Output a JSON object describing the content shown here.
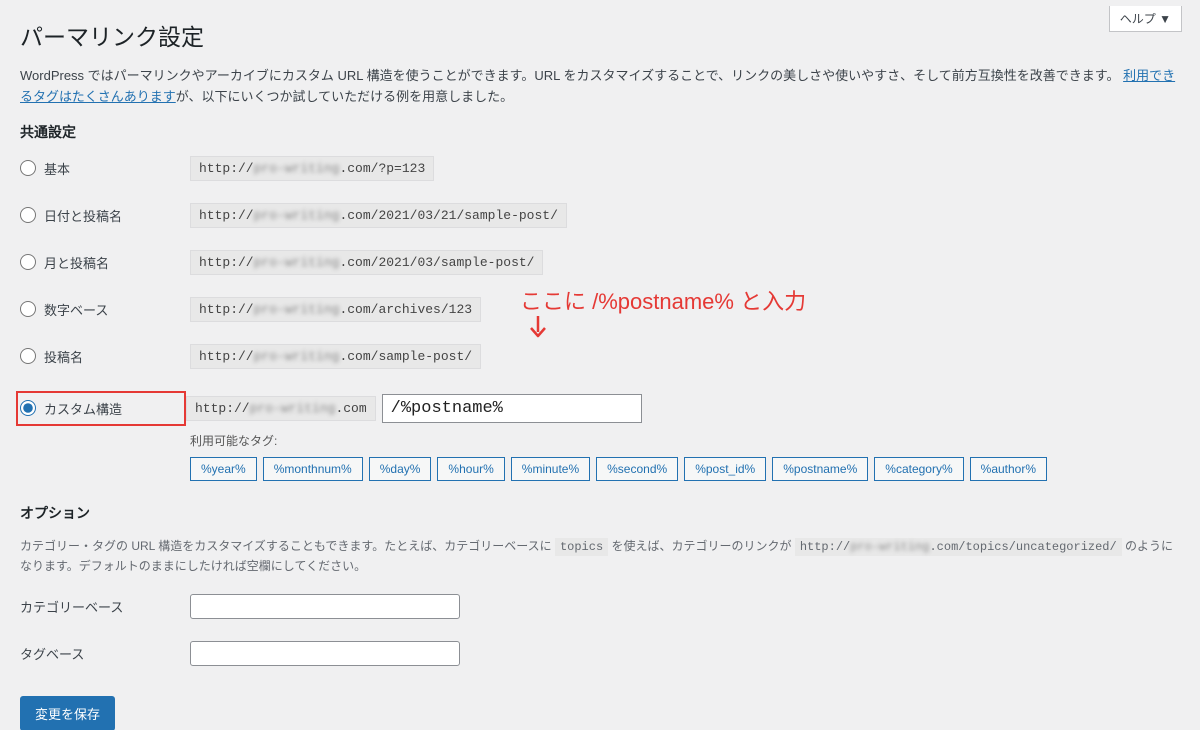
{
  "help_label": "ヘルプ ▼",
  "page_title": "パーマリンク設定",
  "intro_text_1": "WordPress ではパーマリンクやアーカイブにカスタム URL 構造を使うことができます。URL をカスタマイズすることで、リンクの美しさや使いやすさ、そして前方互換性を改善できます。",
  "intro_link": "利用できるタグはたくさんあります",
  "intro_text_2": "が、以下にいくつか試していただける例を用意しました。",
  "common_heading": "共通設定",
  "domain_blur": "pro-writing",
  "http_prefix": "http://",
  "options": {
    "plain": {
      "label": "基本",
      "suffix": ".com/?p=123"
    },
    "dayname": {
      "label": "日付と投稿名",
      "suffix": ".com/2021/03/21/sample-post/"
    },
    "monthname": {
      "label": "月と投稿名",
      "suffix": ".com/2021/03/sample-post/"
    },
    "numeric": {
      "label": "数字ベース",
      "suffix": ".com/archives/123"
    },
    "postname": {
      "label": "投稿名",
      "suffix": ".com/sample-post/"
    },
    "custom": {
      "label": "カスタム構造",
      "suffix": ".com"
    }
  },
  "custom_value": "/%postname%",
  "available_tags_label": "利用可能なタグ:",
  "tags": [
    "%year%",
    "%monthnum%",
    "%day%",
    "%hour%",
    "%minute%",
    "%second%",
    "%post_id%",
    "%postname%",
    "%category%",
    "%author%"
  ],
  "options_heading": "オプション",
  "options_desc_1": "カテゴリー・タグの URL 構造をカスタマイズすることもできます。たとえば、カテゴリーベースに ",
  "options_desc_code1": "topics",
  "options_desc_2": " を使えば、カテゴリーのリンクが ",
  "options_desc_code2_suffix": ".com/topics/uncategorized/",
  "options_desc_3": " のようになります。デフォルトのままにしたければ空欄にしてください。",
  "category_base_label": "カテゴリーベース",
  "tag_base_label": "タグベース",
  "submit_label": "変更を保存",
  "annotation_text": "ここに /%postname% と入力"
}
